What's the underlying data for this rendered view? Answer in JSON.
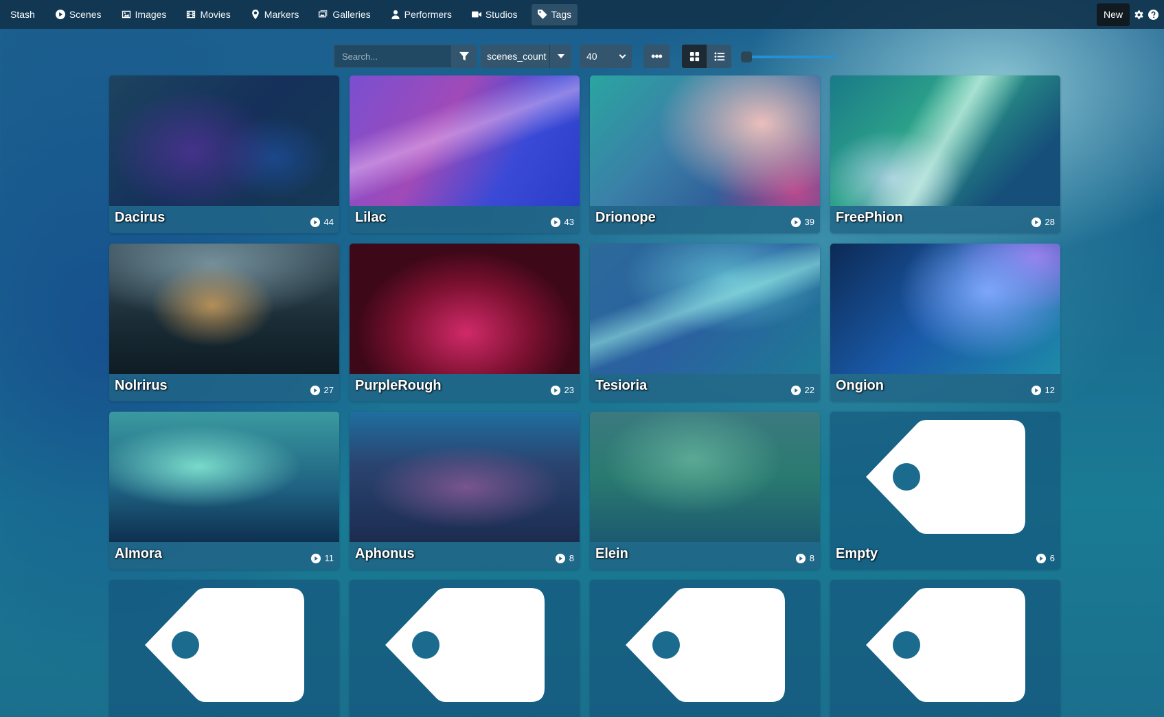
{
  "navbar": {
    "brand": "Stash",
    "items": [
      {
        "label": "Scenes",
        "icon": "play-circle-icon"
      },
      {
        "label": "Images",
        "icon": "image-icon"
      },
      {
        "label": "Movies",
        "icon": "film-icon"
      },
      {
        "label": "Markers",
        "icon": "map-marker-icon"
      },
      {
        "label": "Galleries",
        "icon": "images-icon"
      },
      {
        "label": "Performers",
        "icon": "user-icon"
      },
      {
        "label": "Studios",
        "icon": "video-icon"
      },
      {
        "label": "Tags",
        "icon": "tag-icon",
        "active": true
      }
    ],
    "new_label": "New",
    "right_icons": [
      "gear-icon",
      "question-circle-icon"
    ]
  },
  "toolbar": {
    "search_placeholder": "Search...",
    "sort_by": "scenes_count",
    "per_page": "40",
    "more_label": "•••",
    "view_modes": [
      "grid-icon",
      "list-icon"
    ],
    "active_view": "grid",
    "zoom_level": 0
  },
  "tags": [
    {
      "name": "Dacirus",
      "scenes": "44"
    },
    {
      "name": "Lilac",
      "scenes": "43"
    },
    {
      "name": "Drionope",
      "scenes": "39"
    },
    {
      "name": "FreePhion",
      "scenes": "28"
    },
    {
      "name": "Nolrirus",
      "scenes": "27"
    },
    {
      "name": "PurpleRough",
      "scenes": "23"
    },
    {
      "name": "Tesioria",
      "scenes": "22"
    },
    {
      "name": "Ongion",
      "scenes": "12"
    },
    {
      "name": "Almora",
      "scenes": "11"
    },
    {
      "name": "Aphonus",
      "scenes": "8"
    },
    {
      "name": "Elein",
      "scenes": "8"
    },
    {
      "name": "Empty",
      "scenes": "6"
    },
    {
      "name": "",
      "scenes": ""
    },
    {
      "name": "",
      "scenes": ""
    },
    {
      "name": "",
      "scenes": ""
    },
    {
      "name": "",
      "scenes": ""
    }
  ]
}
